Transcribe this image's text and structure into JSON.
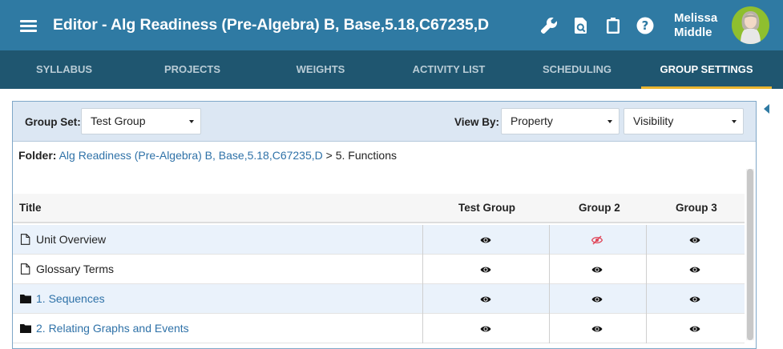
{
  "header": {
    "title": "Editor - Alg Readiness (Pre-Algebra) B, Base,5.18,C67235,D",
    "user_first": "Melissa",
    "user_last": "Middle",
    "tools": [
      "wrench-icon",
      "preview-search-icon",
      "clipboard-icon",
      "help-icon"
    ]
  },
  "tabs": [
    {
      "label": "SYLLABUS",
      "active": false
    },
    {
      "label": "PROJECTS",
      "active": false
    },
    {
      "label": "WEIGHTS",
      "active": false
    },
    {
      "label": "ACTIVITY LIST",
      "active": false
    },
    {
      "label": "SCHEDULING",
      "active": false
    },
    {
      "label": "GROUP SETTINGS",
      "active": true
    }
  ],
  "filters": {
    "group_set_label": "Group Set:",
    "group_set_value": "Test Group",
    "view_by_label": "View By:",
    "view_by_value": "Property",
    "view_by_second_value": "Visibility"
  },
  "folder": {
    "label": "Folder:",
    "path_link": "Alg Readiness (Pre-Algebra) B, Base,5.18,C67235,D",
    "path_rest": " > 5. Functions"
  },
  "table": {
    "columns": [
      "Title",
      "Test Group",
      "Group 2",
      "Group 3"
    ],
    "rows": [
      {
        "title": "Unit Overview",
        "type": "page",
        "visibility": [
          "visible",
          "hidden",
          "visible"
        ]
      },
      {
        "title": "Glossary Terms",
        "type": "page",
        "visibility": [
          "visible",
          "visible",
          "visible"
        ]
      },
      {
        "title": "1. Sequences",
        "type": "folder",
        "visibility": [
          "visible",
          "visible",
          "visible"
        ]
      },
      {
        "title": "2. Relating Graphs and Events",
        "type": "folder",
        "visibility": [
          "visible",
          "visible",
          "visible"
        ]
      }
    ]
  },
  "colors": {
    "header_bg": "#2f7aa3",
    "tabbar_bg": "#1f5670",
    "active_tab_underline": "#e9b52f",
    "link": "#2f72a8",
    "hidden_eye": "#e0475a"
  }
}
